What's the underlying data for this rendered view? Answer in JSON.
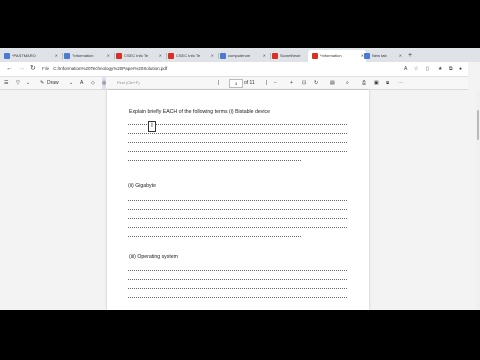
{
  "browser": {
    "tabs": [
      {
        "label": "*PASTMARO",
        "icon_color": "#4a7bd0"
      },
      {
        "label": "\"Information",
        "icon_color": "#4a7bd0"
      },
      {
        "label": "CSEC Info Te",
        "icon_color": "#d93025"
      },
      {
        "label": "CSEC Info Te",
        "icon_color": "#d93025"
      },
      {
        "label": "computerum",
        "icon_color": "#4a7bd0"
      },
      {
        "label": "Scoretheoe",
        "icon_color": "#d93025"
      },
      {
        "label": "*Information",
        "icon_color": "#d93025"
      },
      {
        "label": "New tab",
        "icon_color": "#4a7bd0"
      }
    ],
    "active_tab_index": 6,
    "new_tab_symbol": "+",
    "back_symbol": "←",
    "forward_symbol": "→",
    "refresh_symbol": "↻",
    "file_label": "File",
    "url": "C:/Information%20Technology%20Paper%20Solution.pdf"
  },
  "pdf_toolbar": {
    "draw_label": "Draw",
    "search_placeholder": "Find (Ctrl+F)",
    "page_current": "3",
    "page_total": "of 11"
  },
  "document": {
    "question_intro": "Explain briefly EACH of the following terms (i) Bistable device",
    "question_ii": "(ii) Gigabyte",
    "question_iii": "(iii) Operating system",
    "cursor_glyph": "I"
  },
  "colors": {
    "accent": "#0a66c2",
    "tab_bar": "#dfe3e8"
  }
}
